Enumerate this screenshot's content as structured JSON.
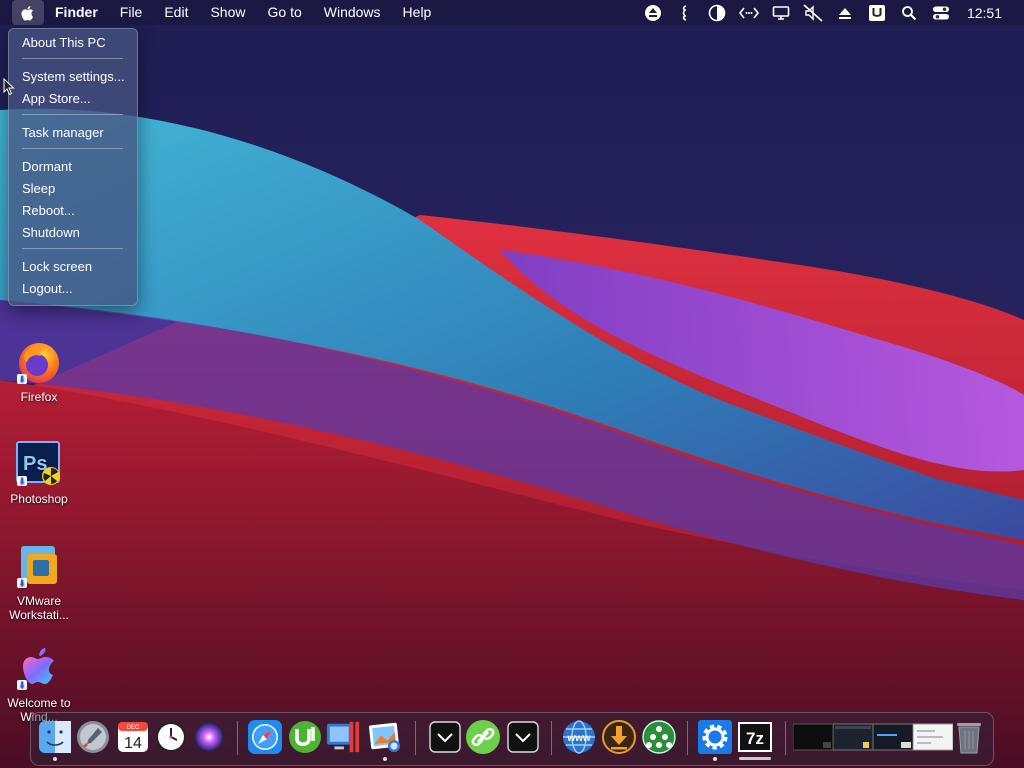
{
  "menubar": {
    "items": [
      "Finder",
      "File",
      "Edit",
      "Show",
      "Go to",
      "Windows",
      "Help"
    ],
    "clock": "12:51",
    "status_icons": [
      "eject-icon",
      "quote-icon",
      "contrast-icon",
      "code-arrows-icon",
      "display-icon",
      "mute-icon",
      "upload-icon",
      "u-app-icon",
      "search-icon",
      "control-center-icon"
    ]
  },
  "apple_menu": {
    "items": [
      "About This PC",
      "System settings...",
      "App Store...",
      "Task manager",
      "Dormant",
      "Sleep",
      "Reboot...",
      "Shutdown",
      "Lock screen",
      "Logout..."
    ]
  },
  "desktop": {
    "icons": [
      {
        "label1": "Firefox",
        "label2": ""
      },
      {
        "label1": "Photoshop",
        "label2": ""
      },
      {
        "label1": "VMware",
        "label2": "Workstati..."
      },
      {
        "label1": "Welcome to",
        "label2": "Wind..."
      }
    ]
  },
  "dock": {
    "calendar_month": "DEC",
    "calendar_day": "14",
    "seven_zip": "7z",
    "icons": [
      "finder-icon",
      "launchpad-icon",
      "calendar-icon",
      "clock-icon",
      "siri-icon",
      "safari-icon",
      "utorrent-icon",
      "folder-icon",
      "parallels-icon",
      "preview-icon",
      "chevron-down-icon",
      "link-icon",
      "chevron-down-icon",
      "www-icon",
      "download-icon",
      "network-icon",
      "settings-gear-icon",
      "seven-zip-icon",
      "window-thumbnail",
      "window-thumbnail",
      "window-thumbnail",
      "window-thumbnail",
      "trash-icon"
    ]
  },
  "colors": {
    "sky_top": "#1f1d53",
    "wave_cyan": "#3aa6c9",
    "wave_red": "#d62a3c",
    "wave_purple": "#a54ee0",
    "menu_bg": "#4a5782"
  }
}
